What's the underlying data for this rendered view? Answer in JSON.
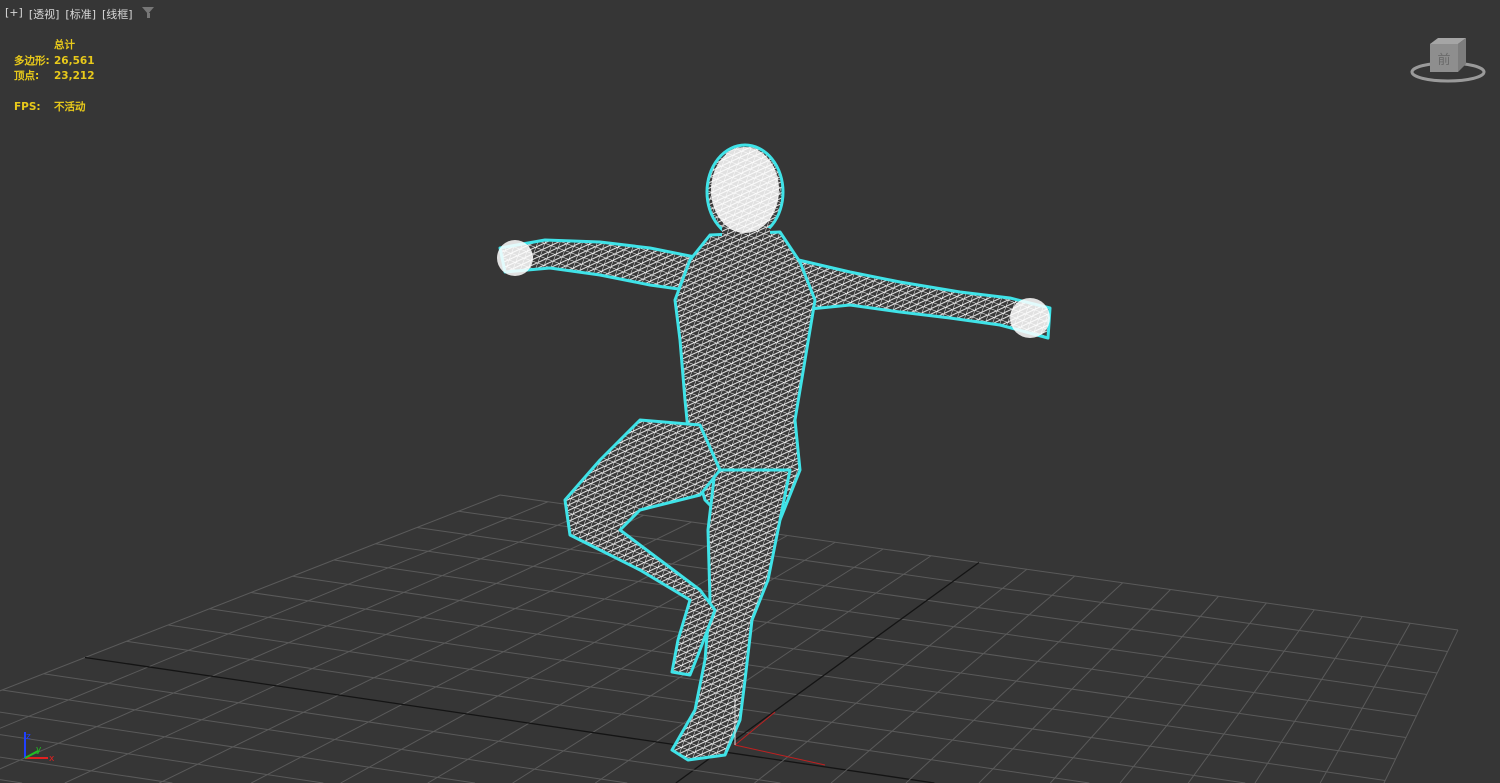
{
  "viewport": {
    "labels": [
      "[+]",
      "[透视]",
      "[标准]",
      "[线框]"
    ],
    "filter_icon": "filter-icon",
    "stats": {
      "header": "总计",
      "polygons_label": "多边形:",
      "polygons_value": "26,561",
      "vertices_label": "顶点:",
      "vertices_value": "23,212",
      "fps_label": "FPS:",
      "fps_value": "不活动"
    },
    "viewcube": {
      "face_label": "前"
    },
    "axis_triad": {
      "x": "x",
      "y": "y",
      "z": "z"
    },
    "colors": {
      "background": "#363636",
      "stats": "#e8c91a",
      "selection": "#3fe3e8",
      "wire": "#ffffff",
      "grid": "#5a5a5a",
      "grid_axis": "#141414"
    }
  }
}
